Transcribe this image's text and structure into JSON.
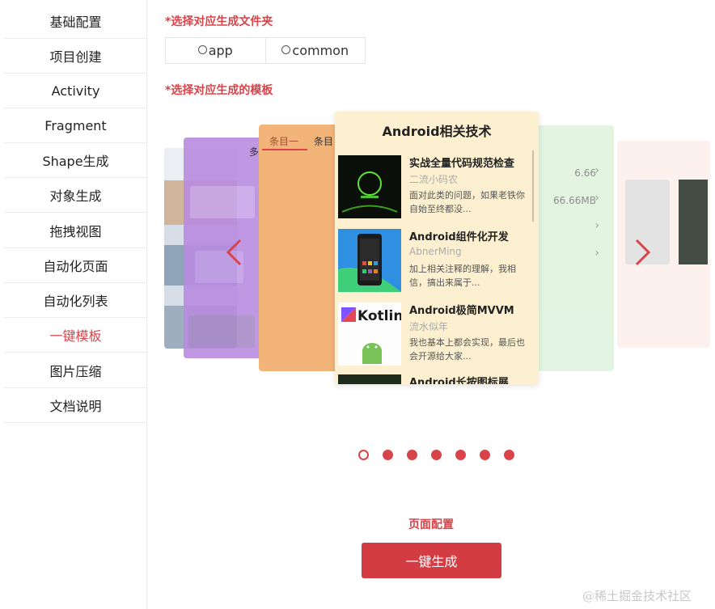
{
  "sidebar": {
    "items": [
      {
        "label": "基础配置"
      },
      {
        "label": "项目创建"
      },
      {
        "label": "Activity"
      },
      {
        "label": "Fragment"
      },
      {
        "label": "Shape生成"
      },
      {
        "label": "对象生成"
      },
      {
        "label": "拖拽视图"
      },
      {
        "label": "自动化页面"
      },
      {
        "label": "自动化列表"
      },
      {
        "label": "一键模板",
        "active": true
      },
      {
        "label": "图片压缩"
      },
      {
        "label": "文档说明"
      }
    ]
  },
  "folder_section": {
    "title": "*选择对应生成文件夹",
    "options": [
      {
        "label": "app"
      },
      {
        "label": "common"
      }
    ]
  },
  "template_section": {
    "title": "*选择对应生成的模板"
  },
  "carousel": {
    "main_card": {
      "title": "Android相关技术",
      "articles": [
        {
          "title": "实战全量代码规范检查",
          "author": "二流小码农",
          "desc": "面对此类的问题，如果老铁你自始至终都没..."
        },
        {
          "title": "Android组件化开发",
          "author": "AbnerMing",
          "desc": "加上相关注释的理解，我相信，搞出来属于..."
        },
        {
          "title": "Android极简MVVM",
          "author": "流水似年",
          "desc": "我也基本上都会实现，最后也会开源给大家..."
        },
        {
          "title": "Android长按图标展",
          "author": "",
          "desc": ""
        }
      ],
      "thumb_kotlin_text": "Kotlin"
    },
    "orange_card": {
      "tabs": [
        "条目一",
        "条目"
      ],
      "side_text": "多"
    },
    "green_card": {
      "rows": [
        "6.66",
        "66.66MB"
      ]
    },
    "slides_count": 7,
    "current_index": 0
  },
  "actions": {
    "config_label": "页面配置",
    "generate_label": "一键生成"
  },
  "watermark": "@稀土掘金技术社区",
  "colors": {
    "accent": "#d9434a",
    "button": "#d43c43"
  }
}
